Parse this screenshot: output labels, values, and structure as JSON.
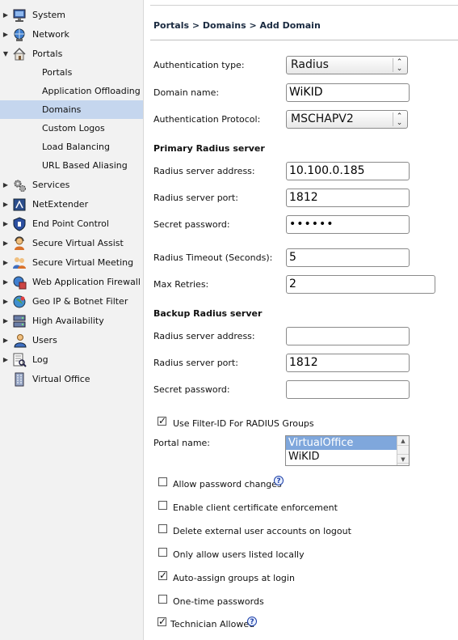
{
  "sidebar": {
    "items": [
      {
        "label": "System",
        "icon": "monitor-icon",
        "expander": "collapsed"
      },
      {
        "label": "Network",
        "icon": "network-globe-icon",
        "expander": "collapsed"
      },
      {
        "label": "Portals",
        "icon": "house-icon",
        "expander": "expanded"
      },
      {
        "label": "Portals",
        "sub": true
      },
      {
        "label": "Application Offloading",
        "sub": true
      },
      {
        "label": "Domains",
        "sub": true,
        "selected": true
      },
      {
        "label": "Custom Logos",
        "sub": true
      },
      {
        "label": "Load Balancing",
        "sub": true
      },
      {
        "label": "URL Based Aliasing",
        "sub": true
      },
      {
        "label": "Services",
        "icon": "gears-icon",
        "expander": "collapsed"
      },
      {
        "label": "NetExtender",
        "icon": "netextender-icon",
        "expander": "collapsed"
      },
      {
        "label": "End Point Control",
        "icon": "shield-icon",
        "expander": "collapsed"
      },
      {
        "label": "Secure Virtual Assist",
        "icon": "support-person-icon",
        "expander": "collapsed"
      },
      {
        "label": "Secure Virtual Meeting",
        "icon": "meeting-people-icon",
        "expander": "collapsed"
      },
      {
        "label": "Web Application Firewall",
        "icon": "firewall-globe-icon",
        "expander": "collapsed"
      },
      {
        "label": "Geo IP & Botnet Filter",
        "icon": "geo-globe-icon",
        "expander": "collapsed"
      },
      {
        "label": "High Availability",
        "icon": "servers-icon",
        "expander": "collapsed"
      },
      {
        "label": "Users",
        "icon": "users-icon",
        "expander": "collapsed"
      },
      {
        "label": "Log",
        "icon": "log-magnifier-icon",
        "expander": "collapsed"
      },
      {
        "label": "Virtual Office",
        "icon": "building-icon",
        "expander": "none"
      }
    ]
  },
  "header": {
    "breadcrumb": "Portals > Domains > Add Domain"
  },
  "form": {
    "auth_type_label": "Authentication type:",
    "auth_type_value": "Radius",
    "domain_name_label": "Domain name:",
    "domain_name_value": "WiKID",
    "auth_protocol_label": "Authentication Protocol:",
    "auth_protocol_value": "MSCHAPV2",
    "primary_section": "Primary Radius server",
    "primary_address_label": "Radius server address:",
    "primary_address_value": "10.100.0.185",
    "primary_port_label": "Radius server port:",
    "primary_port_value": "1812",
    "primary_secret_label": "Secret password:",
    "primary_secret_value": "••••••",
    "timeout_label": "Radius Timeout (Seconds):",
    "timeout_value": "5",
    "retries_label": "Max Retries:",
    "retries_value": "2",
    "backup_section": "Backup Radius server",
    "backup_address_label": "Radius server address:",
    "backup_address_value": "",
    "backup_port_label": "Radius server port:",
    "backup_port_value": "1812",
    "backup_secret_label": "Secret password:",
    "backup_secret_value": "",
    "filter_id_label": "Use Filter-ID For RADIUS Groups",
    "filter_id_checked": true,
    "portal_name_label": "Portal name:",
    "portal_options": [
      "VirtualOffice",
      "WiKID"
    ],
    "portal_selected": "VirtualOffice",
    "options": [
      {
        "label": "Allow password changes",
        "checked": false,
        "help": true
      },
      {
        "label": "Enable client certificate enforcement",
        "checked": false
      },
      {
        "label": "Delete external user accounts on logout",
        "checked": false
      },
      {
        "label": "Only allow users listed locally",
        "checked": false
      },
      {
        "label": "Auto-assign groups at login",
        "checked": true
      },
      {
        "label": "One-time passwords",
        "checked": false
      },
      {
        "label": "Technician Allowed",
        "checked": true,
        "help": true
      }
    ],
    "help_glyph": "?",
    "check_glyph": "✓"
  },
  "colors": {
    "selected_row": "#c5d6ee",
    "list_selection": "#7fa7dc",
    "help_blue": "#1c3fa8"
  }
}
